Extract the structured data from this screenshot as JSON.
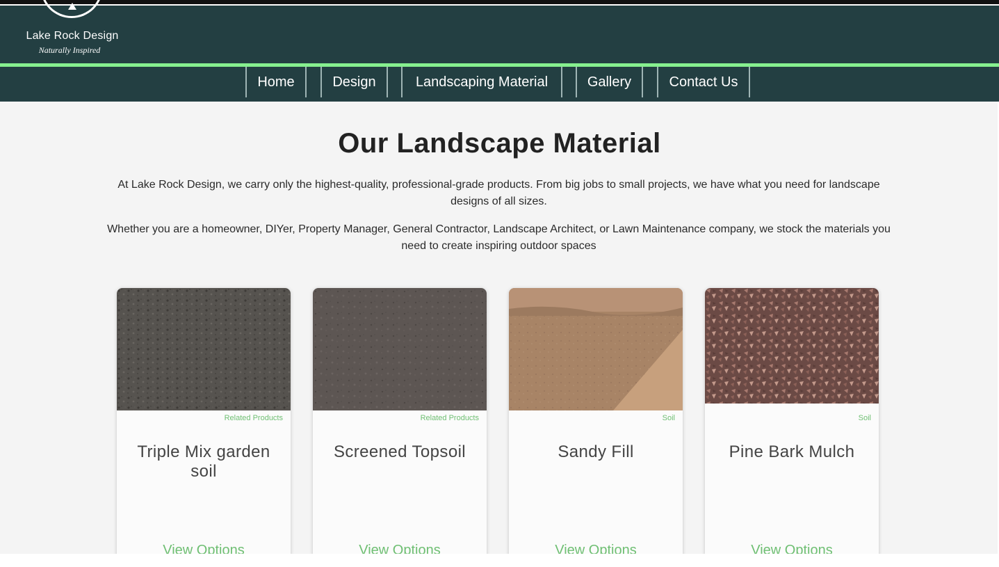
{
  "header": {
    "logo_name": "Lake Rock Design",
    "logo_tagline": "Naturally Inspired",
    "bg_color": "#233f42",
    "accent_color": "#86f08f"
  },
  "nav": {
    "items": [
      {
        "label": "Home"
      },
      {
        "label": "Design"
      },
      {
        "label": "Landscaping Material"
      },
      {
        "label": "Gallery"
      },
      {
        "label": "Contact Us"
      }
    ]
  },
  "main": {
    "title": "Our Landscape Material",
    "intro_1": "At Lake Rock Design, we carry only the highest-quality, professional-grade products. From big jobs to small projects, we have what you need for landscape designs of all sizes.",
    "intro_2": "Whether you are a homeowner, DIYer, Property Manager, General Contractor, Landscape Architect, or Lawn Maintenance company, we stock the materials you need to create inspiring outdoor spaces"
  },
  "products": [
    {
      "category": "Related Products",
      "name": "Triple Mix garden soil",
      "button": "View Options",
      "image": "dark-soil-image"
    },
    {
      "category": "Related Products",
      "name": "Screened Topsoil",
      "button": "View Options",
      "image": "topsoil-image"
    },
    {
      "category": "Soil",
      "name": "Sandy Fill",
      "button": "View Options",
      "image": "sand-pile-image"
    },
    {
      "category": "Soil",
      "name": "Pine Bark Mulch",
      "button": "View Options",
      "image": "bark-mulch-image"
    }
  ]
}
